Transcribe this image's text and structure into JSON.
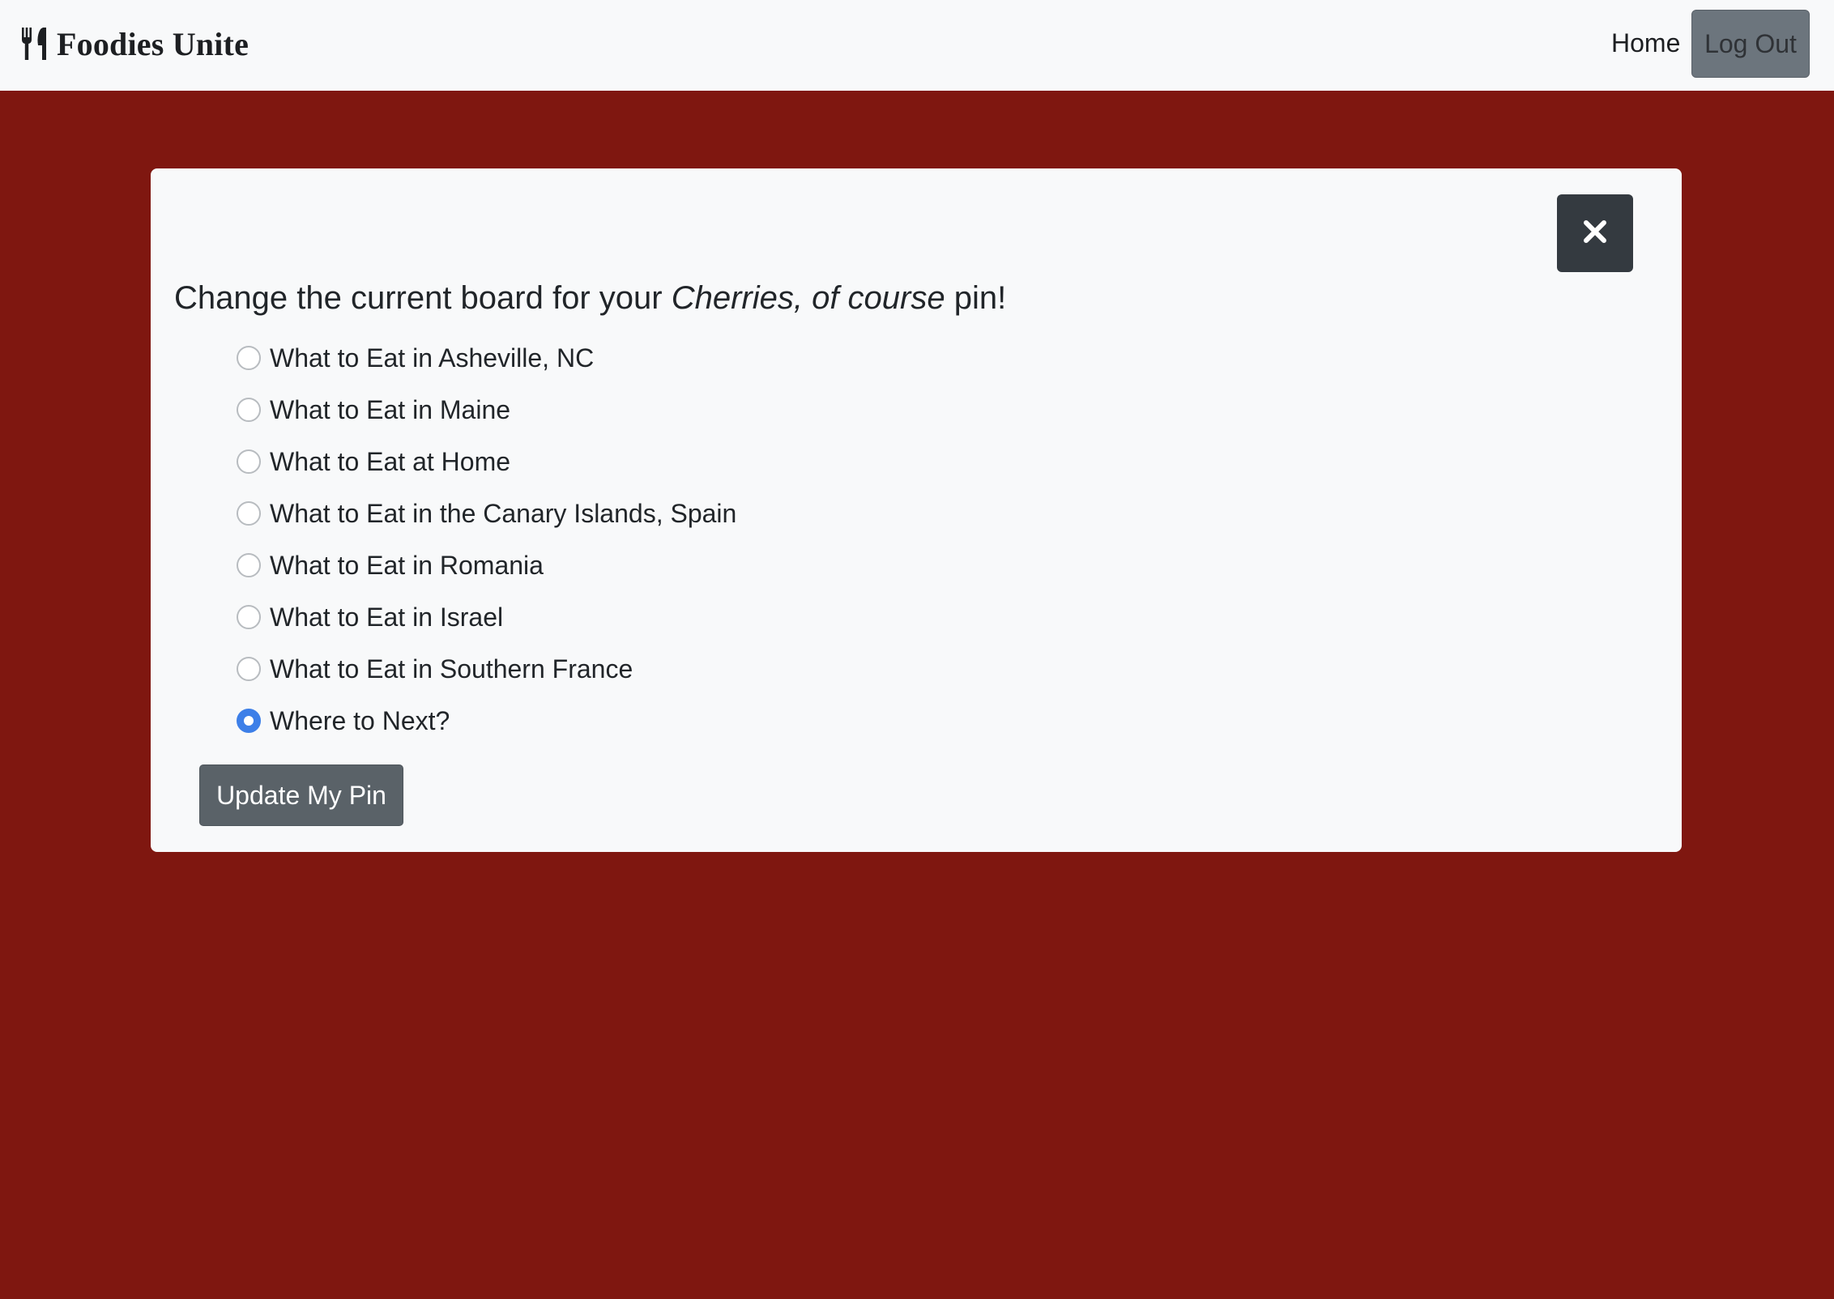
{
  "navbar": {
    "brand_icon": "utensils-icon",
    "brand_name": "Foodies Unite",
    "home_label": "Home",
    "logout_label": "Log Out"
  },
  "modal": {
    "close_icon": "close-icon",
    "heading_prefix": "Change the current board for your ",
    "pin_name": "Cherries, of course",
    "heading_suffix": " pin!",
    "options": [
      {
        "label": "What to Eat in Asheville, NC",
        "checked": false
      },
      {
        "label": "What to Eat in Maine",
        "checked": false
      },
      {
        "label": "What to Eat at Home",
        "checked": false
      },
      {
        "label": "What to Eat in the Canary Islands, Spain",
        "checked": false
      },
      {
        "label": "What to Eat in Romania",
        "checked": false
      },
      {
        "label": "What to Eat in Israel",
        "checked": false
      },
      {
        "label": "What to Eat in Southern France",
        "checked": false
      },
      {
        "label": "Where to Next?",
        "checked": true
      }
    ],
    "submit_label": "Update My Pin"
  },
  "colors": {
    "page_background": "#7f1710",
    "navbar_background": "#f8f9fa",
    "card_background": "#f8f9fa",
    "close_button": "#343a40",
    "radio_checked": "#3d7fe8",
    "secondary_button": "#6c757d"
  }
}
